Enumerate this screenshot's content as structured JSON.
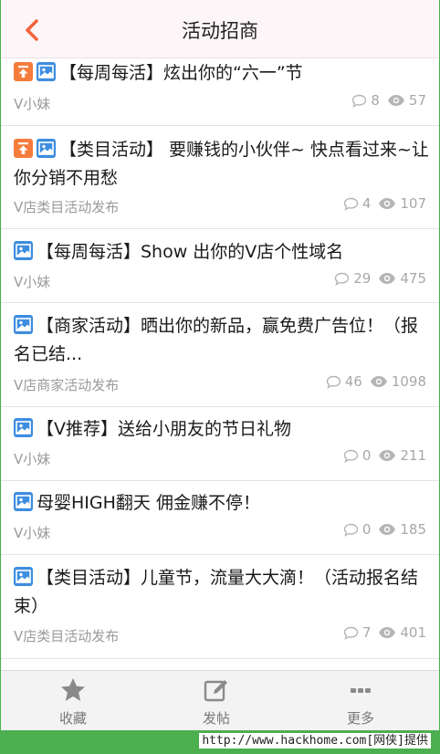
{
  "header": {
    "title": "活动招商"
  },
  "posts": [
    {
      "title": "【每周每活】炫出你的“六一”节",
      "author": "V小妹",
      "comments": "8",
      "views": "57",
      "pinned": true
    },
    {
      "title": "【类目活动】 要赚钱的小伙伴~ 快点看过来~让你分销不用愁",
      "author": "V店类目活动发布",
      "comments": "4",
      "views": "107",
      "pinned": true
    },
    {
      "title": "【每周每活】Show 出你的V店个性域名",
      "author": "V小妹",
      "comments": "29",
      "views": "475",
      "pinned": false
    },
    {
      "title": "【商家活动】晒出你的新品，赢免费广告位！（报名已结...",
      "author": "V店商家活动发布",
      "comments": "46",
      "views": "1098",
      "pinned": false
    },
    {
      "title": "【V推荐】送给小朋友的节日礼物",
      "author": "V小妹",
      "comments": "0",
      "views": "211",
      "pinned": false
    },
    {
      "title": "母婴HIGH翻天 佣金赚不停！",
      "author": "V小妹",
      "comments": "0",
      "views": "185",
      "pinned": false
    },
    {
      "title": "【类目活动】儿童节，流量大大滴！（活动报名结束）",
      "author": "V店类目活动发布",
      "comments": "7",
      "views": "401",
      "pinned": false
    }
  ],
  "tabbar": {
    "favorites": "收藏",
    "post": "发帖",
    "more": "更多"
  },
  "watermark": {
    "prefix": "http://www.hackhome.com",
    "suffix": "[网侠]提供"
  },
  "colors": {
    "accent": "#f4623a",
    "pin_badge": "#f57c3c",
    "image_badge": "#3d8de0",
    "header_bg": "#fdf6f9"
  },
  "icons": {
    "back": "chevron-left-icon",
    "pin": "pin-top-icon",
    "image": "image-icon",
    "comment": "comment-icon",
    "view": "eye-icon",
    "star": "star-icon",
    "edit": "edit-icon",
    "more": "more-dots-icon"
  }
}
